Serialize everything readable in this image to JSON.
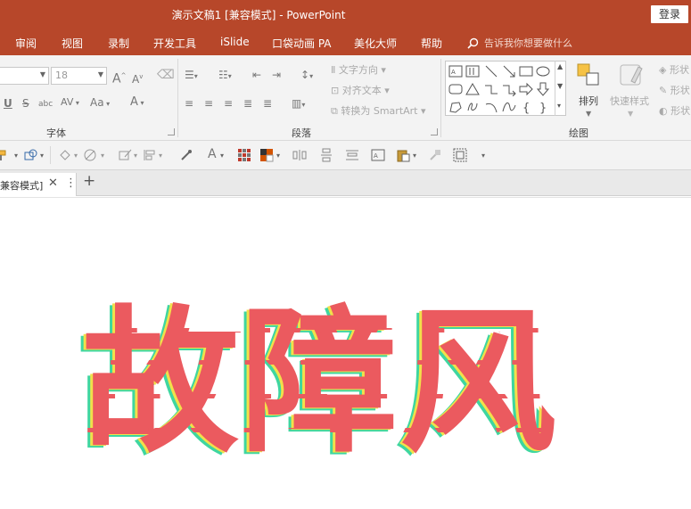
{
  "window": {
    "title": "演示文稿1 [兼容模式]  -  PowerPoint",
    "login_label": "登录"
  },
  "ribbon_tabs": [
    "审阅",
    "视图",
    "录制",
    "开发工具",
    "iSlide",
    "口袋动画 PA",
    "美化大师",
    "帮助"
  ],
  "tell_me": {
    "placeholder": "告诉我你想要做什么"
  },
  "font_group": {
    "label": "字体",
    "font_name": "",
    "font_size": "18",
    "bold_label": "U",
    "strike_label": "S",
    "shadow_label": "abc",
    "spacing_label": "AV",
    "case_label": "Aa",
    "grow_label": "A",
    "shrink_label": "A",
    "color_label": "A"
  },
  "paragraph_group": {
    "label": "段落",
    "text_direction_label": "文字方向",
    "align_text_label": "对齐文本",
    "smartart_label": "转换为 SmartArt"
  },
  "drawing_group": {
    "label": "绘图",
    "arrange_label": "排列",
    "quick_styles_label": "快速样式",
    "shape_fill_label": "形状",
    "shape_outline_label": "形状",
    "shape_effects_label": "形状"
  },
  "document_tab": {
    "name": "兼容模式]"
  },
  "slide": {
    "text": "故障风"
  },
  "colors": {
    "accent": "#b7472a",
    "glitch_red": "#eb5a5f",
    "glitch_yellow": "#f2e04a",
    "glitch_green": "#3ed6a0"
  }
}
